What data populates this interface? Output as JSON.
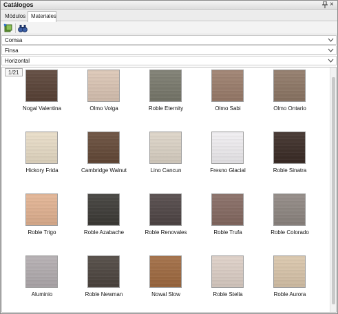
{
  "window": {
    "title": "Catálogos"
  },
  "tabs": [
    {
      "label": "Módulos"
    },
    {
      "label": "Materiales"
    }
  ],
  "toolbar": {
    "buttons": [
      {
        "icon": "add-material-icon"
      },
      {
        "icon": "binoculars-search-icon"
      }
    ]
  },
  "filters": [
    {
      "value": "Comsa"
    },
    {
      "value": "Finsa"
    },
    {
      "value": "Horizontal"
    }
  ],
  "gallery": {
    "page": "1/21",
    "materials": [
      {
        "name": "Nogal Valentina",
        "color": "#5a4337"
      },
      {
        "name": "Olmo Volga",
        "color": "#dcc6b5"
      },
      {
        "name": "Roble Eternity",
        "color": "#7a7a6d"
      },
      {
        "name": "Olmo Sabi",
        "color": "#9c7e6c"
      },
      {
        "name": "Olmo Ontario",
        "color": "#8f7866"
      },
      {
        "name": "Hickory Frida",
        "color": "#e9ddc7"
      },
      {
        "name": "Cambridge Walnut",
        "color": "#654a38"
      },
      {
        "name": "Lino Cancun",
        "color": "#ddd4c7"
      },
      {
        "name": "Fresno Glacial",
        "color": "#f1eff2"
      },
      {
        "name": "Roble Sinatra",
        "color": "#3b2c26"
      },
      {
        "name": "Roble Trigo",
        "color": "#e3b392"
      },
      {
        "name": "Roble Azabache",
        "color": "#3d3b37"
      },
      {
        "name": "Roble Renovales",
        "color": "#504646"
      },
      {
        "name": "Roble Trufa",
        "color": "#866a62"
      },
      {
        "name": "Roble Colorado",
        "color": "#8f8782"
      },
      {
        "name": "Aluminio",
        "color": "#b3adb0"
      },
      {
        "name": "Roble Newman",
        "color": "#4d453f"
      },
      {
        "name": "Nowal Slow",
        "color": "#a06a40"
      },
      {
        "name": "Roble Stella",
        "color": "#ded0c7"
      },
      {
        "name": "Roble Aurora",
        "color": "#dac6ab"
      }
    ]
  }
}
